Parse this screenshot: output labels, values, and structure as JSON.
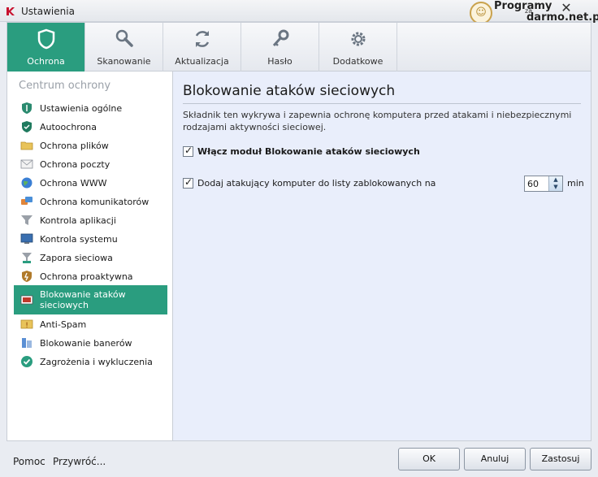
{
  "window": {
    "title": "Ustawienia",
    "close_glyph": "✕"
  },
  "watermark": {
    "line1": "Programy",
    "line2": "za",
    "line3": "darmo.net.pl"
  },
  "tabs": [
    {
      "label": "Ochrona",
      "icon": "shield-icon",
      "active": true
    },
    {
      "label": "Skanowanie",
      "icon": "magnifier-icon",
      "active": false
    },
    {
      "label": "Aktualizacja",
      "icon": "refresh-icon",
      "active": false
    },
    {
      "label": "Hasło",
      "icon": "key-icon",
      "active": false
    },
    {
      "label": "Dodatkowe",
      "icon": "gear-icon",
      "active": false
    }
  ],
  "sidebar": {
    "title": "Centrum ochrony",
    "items": [
      {
        "label": "Ustawienia ogólne",
        "icon": "shield-settings-icon"
      },
      {
        "label": "Autoochrona",
        "icon": "self-defense-icon"
      },
      {
        "label": "Ochrona plików",
        "icon": "folder-icon"
      },
      {
        "label": "Ochrona poczty",
        "icon": "mail-icon"
      },
      {
        "label": "Ochrona WWW",
        "icon": "globe-icon"
      },
      {
        "label": "Ochrona komunikatorów",
        "icon": "messenger-icon"
      },
      {
        "label": "Kontrola aplikacji",
        "icon": "funnel-icon"
      },
      {
        "label": "Kontrola systemu",
        "icon": "monitor-icon"
      },
      {
        "label": "Zapora sieciowa",
        "icon": "firewall-icon"
      },
      {
        "label": "Ochrona proaktywna",
        "icon": "proactive-shield-icon"
      },
      {
        "label": "Blokowanie ataków sieciowych",
        "icon": "network-attack-icon",
        "active": true
      },
      {
        "label": "Anti-Spam",
        "icon": "spam-icon"
      },
      {
        "label": "Blokowanie banerów",
        "icon": "banner-icon"
      },
      {
        "label": "Zagrożenia i wykluczenia",
        "icon": "check-circle-icon"
      }
    ]
  },
  "content": {
    "title": "Blokowanie ataków sieciowych",
    "description": "Składnik ten wykrywa i zapewnia ochronę komputera przed atakami i niebezpiecznymi rodzajami aktywności sieciowej.",
    "option_enable": {
      "label": "Włącz moduł Blokowanie ataków sieciowych",
      "checked": true
    },
    "option_block": {
      "label": "Dodaj atakujący komputer do listy zablokowanych na",
      "checked": true,
      "value": "60",
      "unit": "min"
    }
  },
  "footer": {
    "help_label": "Pomoc",
    "restore_label": "Przywróć...",
    "ok_label": "OK",
    "cancel_label": "Anuluj",
    "apply_label": "Zastosuj"
  },
  "colors": {
    "accent": "#2a9d7f",
    "content_bg": "#e9eefb",
    "sidebar_bg": "#ffffff"
  }
}
